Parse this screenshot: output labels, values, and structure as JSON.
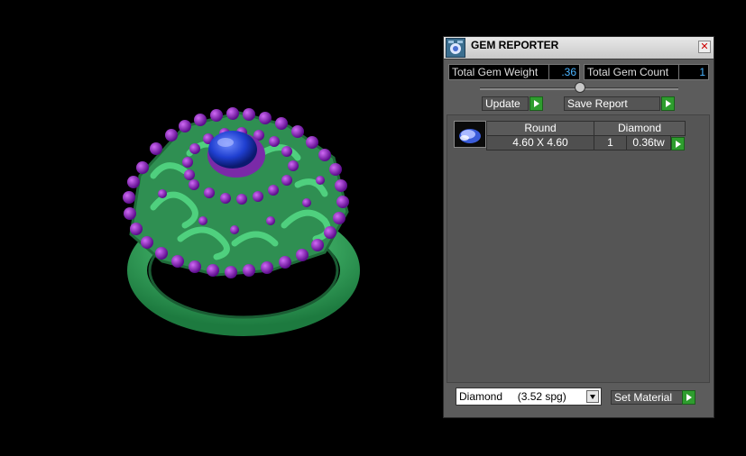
{
  "panel": {
    "title": "GEM REPORTER",
    "close_icon": "close-icon",
    "app_icon": "gem-reporter-app-icon"
  },
  "stats": {
    "total_weight_label": "Total Gem Weight",
    "total_weight_value": ".36",
    "total_count_label": "Total Gem Count",
    "total_count_value": "1"
  },
  "actions": {
    "update_label": "Update",
    "save_report_label": "Save Report"
  },
  "gems": [
    {
      "shape": "Round",
      "material": "Diamond",
      "size": "4.60 X 4.60",
      "count": "1",
      "weight": "0.36tw"
    }
  ],
  "material": {
    "selected": "Diamond     (3.52 spg)",
    "set_label": "Set Material"
  },
  "colors": {
    "accent_green": "#2e9d2e",
    "value_blue": "#4ab3ff",
    "ring_green": "#3dbd6a",
    "bead_purple": "#8b1fbf",
    "stone_blue": "#1f3fd0"
  }
}
